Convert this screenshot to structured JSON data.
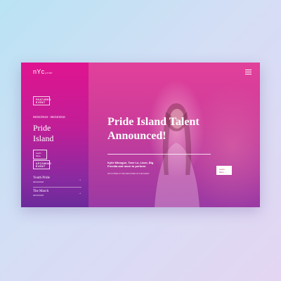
{
  "brand": {
    "logo": "nYc",
    "logo_suffix": "pride"
  },
  "sidebar": {
    "featured_tag_line1": "FEATURED",
    "featured_tag_line2": "EVENT",
    "featured_dates": "06/22/2018 - 06/24/2018",
    "featured_title_line1": "Pride",
    "featured_title_line2": "Island",
    "learn_more": "Learn More",
    "upcoming_tag_line1": "UPCOMING",
    "upcoming_tag_line2": "EVENT",
    "events": [
      {
        "name": "Youth Pride",
        "date": "06/23/2018",
        "arrow": "→"
      },
      {
        "name": "The March",
        "date": "06/24/2018",
        "arrow": "→"
      }
    ]
  },
  "hero": {
    "title_line1": "Pride Island Talent",
    "title_line2": "Announced!",
    "description": "Kylie Minogue, Tove Lo, Lizzo, Big Freedia and more to perform",
    "subtext": "WITH PRIDE AT THE NEW HOME OF THE EVENT",
    "learn_more": "Learn More →"
  },
  "colors": {
    "sidebar_top": "#e0148f",
    "sidebar_bottom": "#6c2a9a",
    "hero_accent": "#cd3c9a",
    "button_text": "#c0246f"
  },
  "icons": {
    "menu": "hamburger-menu-icon",
    "arrow": "arrow-right-icon"
  }
}
